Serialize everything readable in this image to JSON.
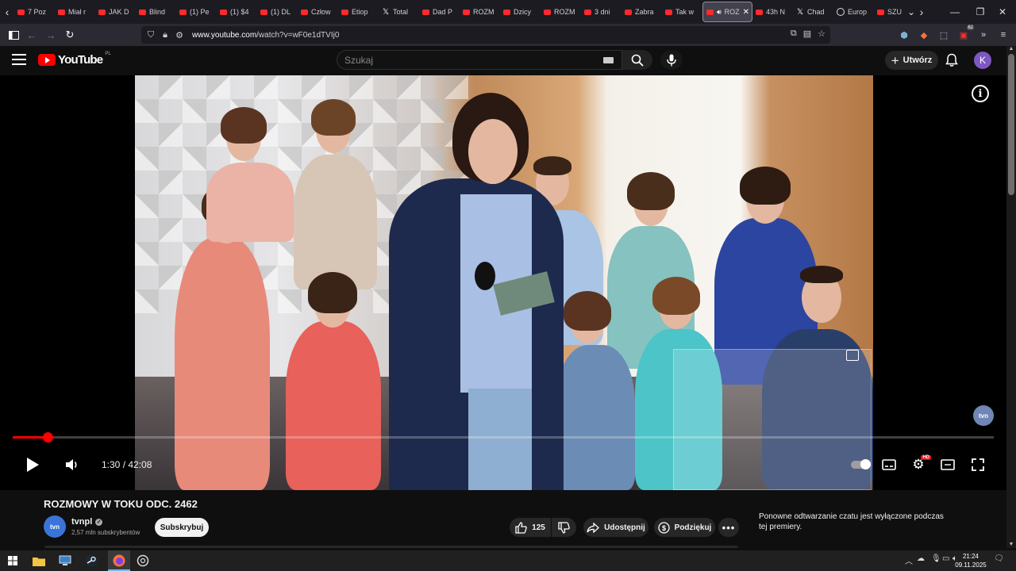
{
  "browser": {
    "tabs": [
      {
        "label": "7 Poz",
        "icon": "youtube-favicon"
      },
      {
        "label": "Miał r",
        "icon": "youtube-favicon"
      },
      {
        "label": "JAK D",
        "icon": "youtube-favicon"
      },
      {
        "label": "Blind",
        "icon": "youtube-favicon"
      },
      {
        "label": "(1) Pe",
        "icon": "youtube-favicon"
      },
      {
        "label": "(1) $4",
        "icon": "youtube-favicon"
      },
      {
        "label": "(1) DL",
        "icon": "youtube-favicon"
      },
      {
        "label": "Człow",
        "icon": "youtube-favicon"
      },
      {
        "label": "Etiop",
        "icon": "youtube-favicon"
      },
      {
        "label": "Total",
        "icon": "x-favicon"
      },
      {
        "label": "Dad P",
        "icon": "youtube-favicon"
      },
      {
        "label": "ROZM",
        "icon": "youtube-favicon"
      },
      {
        "label": "Dzicy",
        "icon": "youtube-favicon"
      },
      {
        "label": "ROZM",
        "icon": "youtube-favicon"
      },
      {
        "label": "3 dni",
        "icon": "youtube-favicon"
      },
      {
        "label": "Zabra",
        "icon": "youtube-favicon"
      },
      {
        "label": "Tak w",
        "icon": "youtube-favicon"
      },
      {
        "label": "ROZ",
        "icon": "youtube-favicon",
        "active": true
      },
      {
        "label": "43h N",
        "icon": "youtube-favicon"
      },
      {
        "label": "Chad",
        "icon": "x-favicon"
      },
      {
        "label": "Europ",
        "icon": "globe-favicon"
      },
      {
        "label": "SZU",
        "icon": "youtube-favicon"
      }
    ],
    "url_host": "www.youtube.com",
    "url_path": "/watch?v=wF0e1dTVIj0",
    "ext_badge": "62"
  },
  "youtube": {
    "logo_text": "YouTube",
    "logo_country": "PL",
    "search_placeholder": "Szukaj",
    "create_label": "Utwórz",
    "avatar_letter": "K"
  },
  "player": {
    "current_time": "1:30",
    "duration": "42:08",
    "time_display": "1:30 / 42:08",
    "progress_fraction": 0.0356,
    "watermark": "tvn",
    "hd_badge": "HD"
  },
  "video": {
    "title": "ROZMOWY W TOKU ODC. 2462",
    "channel_name": "tvnpl",
    "channel_avatar_text": "tvn",
    "subscribers": "2,57 mln subskrybentów",
    "subscribe_label": "Subskrybuj",
    "like_count": "125",
    "share_label": "Udostępnij",
    "thanks_label": "Podziękuj",
    "chat_note": "Ponowne odtwarzanie czatu jest wyłączone podczas tej premiery."
  },
  "taskbar": {
    "time": "21:24",
    "date": "09.11.2025"
  },
  "colors": {
    "yt_red": "#ff0000",
    "bg": "#0f0f0f",
    "pill": "#272727"
  }
}
